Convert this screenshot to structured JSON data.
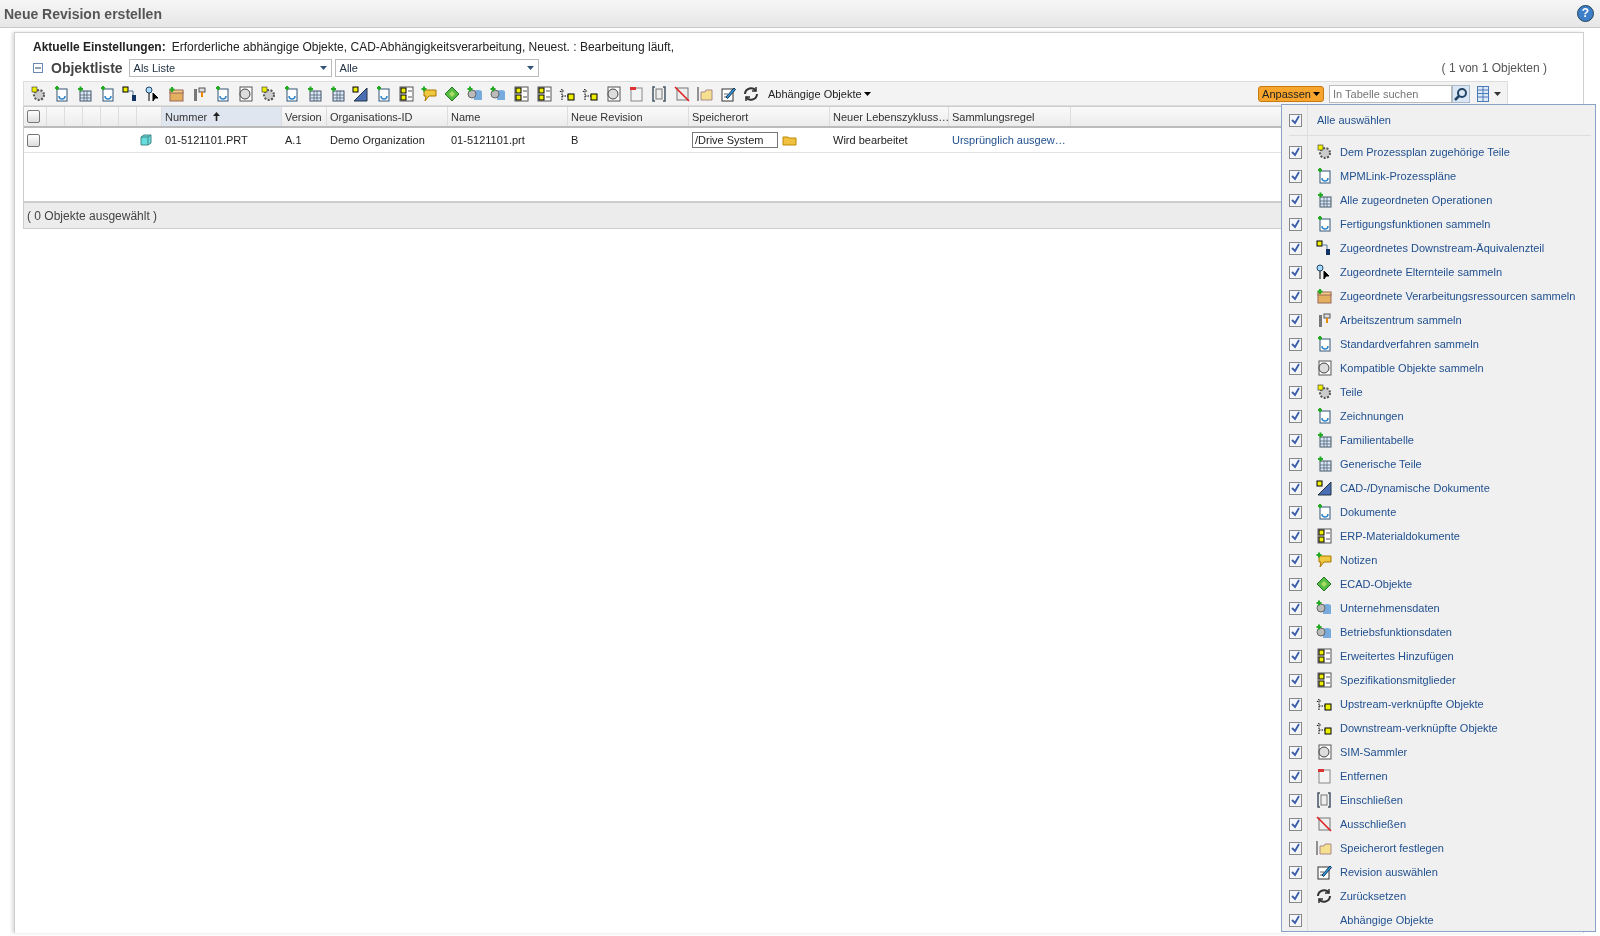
{
  "window": {
    "title": "Neue Revision erstellen",
    "help": "?"
  },
  "settings": {
    "label": "Aktuelle Einstellungen:",
    "value": "Erforderliche abhängige Objekte, CAD-Abhängigkeitsverarbeitung, Neuest. : Bearbeitung läuft,"
  },
  "object_list": {
    "title": "Objektliste",
    "expanded": true,
    "view": "Als Liste",
    "filter": "Alle",
    "count": "( 1 von 1 Objekten )"
  },
  "toolbar": {
    "dependents_menu": "Abhängige Objekte",
    "customize": "Anpassen",
    "search": {
      "placeholder": "In Tabelle suchen"
    }
  },
  "table": {
    "all_selected": false,
    "columns": [
      {
        "label": "Nummer",
        "sorted": true
      },
      {
        "label": "Version",
        "sorted": false
      },
      {
        "label": "Organisations-ID",
        "sorted": false
      },
      {
        "label": "Name",
        "sorted": false
      },
      {
        "label": "Neue Revision",
        "sorted": false
      },
      {
        "label": "Speicherort",
        "sorted": false
      },
      {
        "label": "Neuer Lebenszykluss…",
        "sorted": false
      },
      {
        "label": "Sammlungsregel",
        "sorted": false
      }
    ],
    "rows": [
      {
        "selected": false,
        "cells": [
          "01-5121101.PRT",
          "A.1",
          "Demo Organization",
          "01-5121101.prt",
          "B",
          "/Drive System",
          "Wird bearbeitet",
          "Ursprünglich ausgew…"
        ]
      }
    ],
    "footer": "( 0 Objekte ausgewählt )"
  },
  "menu": {
    "select_all": {
      "label": "Alle auswählen",
      "checked": true
    },
    "items": [
      {
        "label": "Dem Prozessplan zugehörige Teile",
        "checked": true
      },
      {
        "label": "MPMLink-Prozesspläne",
        "checked": true
      },
      {
        "label": "Alle zugeordneten Operationen",
        "checked": true
      },
      {
        "label": "Fertigungsfunktionen sammeln",
        "checked": true
      },
      {
        "label": "Zugeordnetes Downstream-Äquivalenzteil",
        "checked": true
      },
      {
        "label": "Zugeordnete Elternteile sammeln",
        "checked": true
      },
      {
        "label": "Zugeordnete Verarbeitungsressourcen sammeln",
        "checked": true
      },
      {
        "label": "Arbeitszentrum sammeln",
        "checked": true
      },
      {
        "label": "Standardverfahren sammeln",
        "checked": true
      },
      {
        "label": "Kompatible Objekte sammeln",
        "checked": true
      },
      {
        "label": "Teile",
        "checked": true
      },
      {
        "label": "Zeichnungen",
        "checked": true
      },
      {
        "label": "Familientabelle",
        "checked": true
      },
      {
        "label": "Generische Teile",
        "checked": true
      },
      {
        "label": "CAD-/Dynamische Dokumente",
        "checked": true
      },
      {
        "label": "Dokumente",
        "checked": true
      },
      {
        "label": "ERP-Materialdokumente",
        "checked": true
      },
      {
        "label": "Notizen",
        "checked": true
      },
      {
        "label": "ECAD-Objekte",
        "checked": true
      },
      {
        "label": "Unternehmensdaten",
        "checked": true
      },
      {
        "label": "Betriebsfunktionsdaten",
        "checked": true
      },
      {
        "label": "Erweitertes Hinzufügen",
        "checked": true
      },
      {
        "label": "Spezifikationsmitglieder",
        "checked": true
      },
      {
        "label": "Upstream-verknüpfte Objekte",
        "checked": true
      },
      {
        "label": "Downstream-verknüpfte Objekte",
        "checked": true
      },
      {
        "label": "SIM-Sammler",
        "checked": true
      },
      {
        "label": "Entfernen",
        "checked": true
      },
      {
        "label": "Einschließen",
        "checked": true
      },
      {
        "label": "Ausschließen",
        "checked": true
      },
      {
        "label": "Speicherort festlegen",
        "checked": true
      },
      {
        "label": "Revision auswählen",
        "checked": true
      },
      {
        "label": "Zurücksetzen",
        "checked": true
      },
      {
        "label": "Abhängige Objekte",
        "checked": true
      }
    ]
  }
}
